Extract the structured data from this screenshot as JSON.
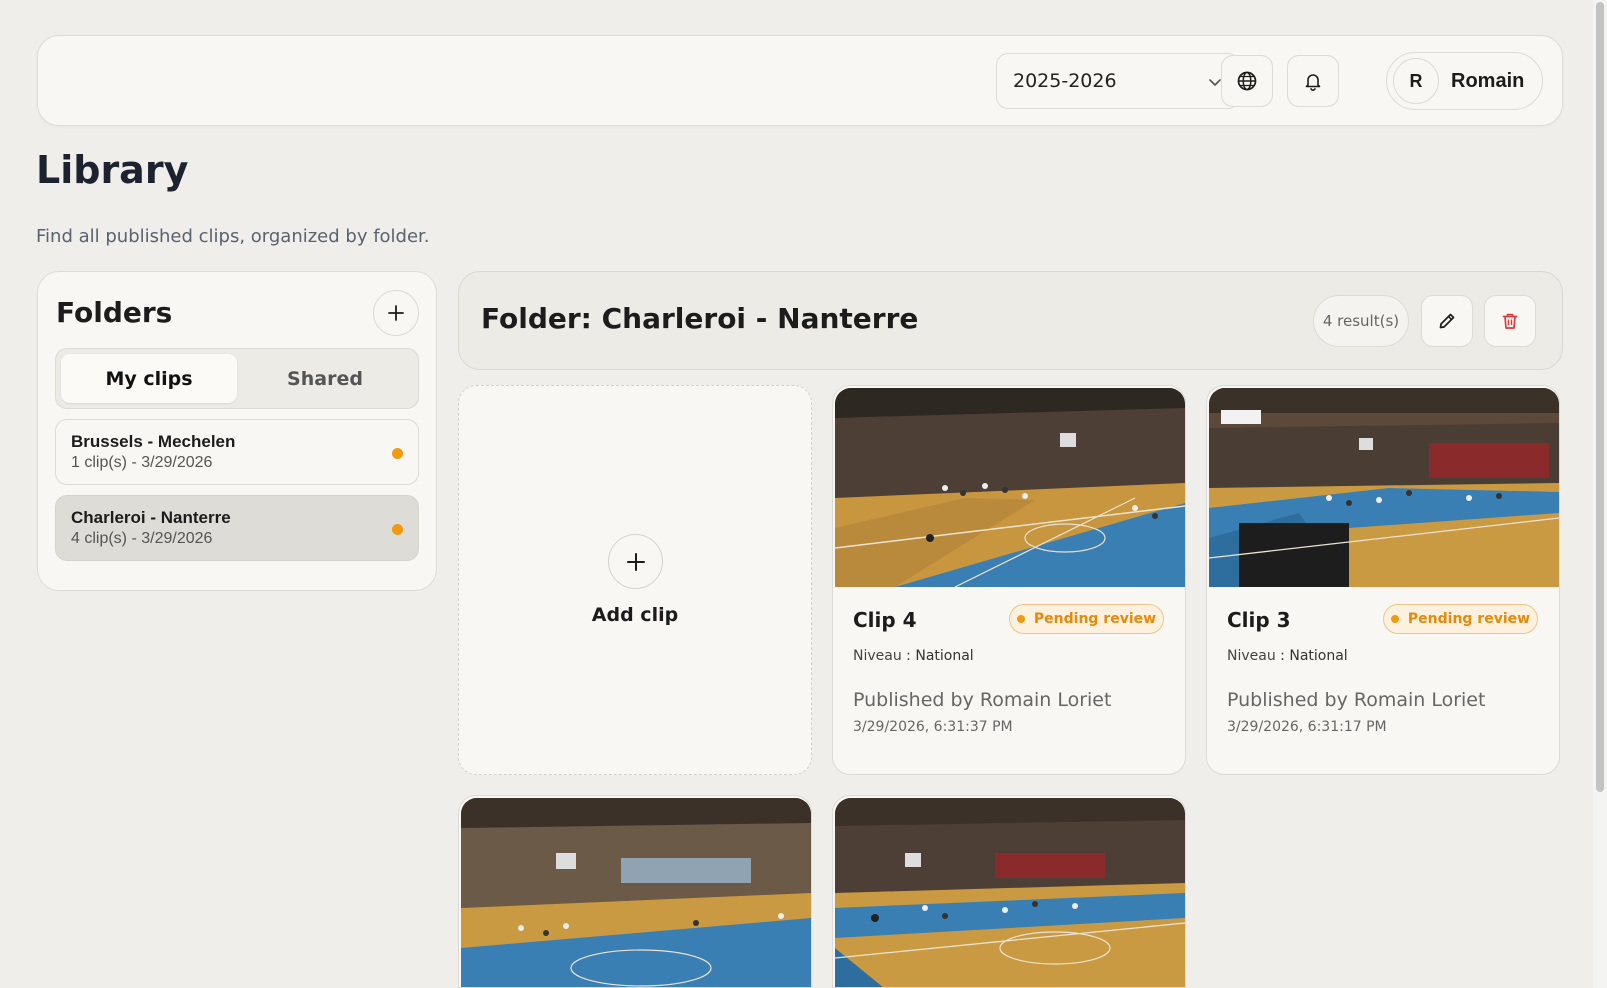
{
  "topbar": {
    "season": "2025-2026",
    "user": {
      "initial": "R",
      "name": "Romain"
    }
  },
  "page": {
    "title": "Library",
    "subtitle": "Find all published clips, organized by folder."
  },
  "folders": {
    "title": "Folders",
    "tabs": [
      {
        "label": "My clips",
        "active": true
      },
      {
        "label": "Shared",
        "active": false
      }
    ],
    "items": [
      {
        "name": "Brussels - Mechelen",
        "meta": "1 clip(s) - 3/29/2026",
        "active": false
      },
      {
        "name": "Charleroi - Nanterre",
        "meta": "4 clip(s) - 3/29/2026",
        "active": true
      }
    ]
  },
  "folder_view": {
    "title": "Folder: Charleroi - Nanterre",
    "result_count": "4 result(s)",
    "add_clip_label": "Add clip",
    "clips": [
      {
        "title": "Clip 4",
        "status": "Pending review",
        "level_label": "Niveau",
        "level_value": "National",
        "published_by": "Published by Romain Loriet",
        "date": "3/29/2026, 6:31:37 PM"
      },
      {
        "title": "Clip 3",
        "status": "Pending review",
        "level_label": "Niveau",
        "level_value": "National",
        "published_by": "Published by Romain Loriet",
        "date": "3/29/2026, 6:31:17 PM"
      }
    ]
  },
  "colors": {
    "background": "#efeeea",
    "surface": "#f8f7f3",
    "accent_orange": "#f29a0c",
    "delete_red": "#e0393b"
  }
}
